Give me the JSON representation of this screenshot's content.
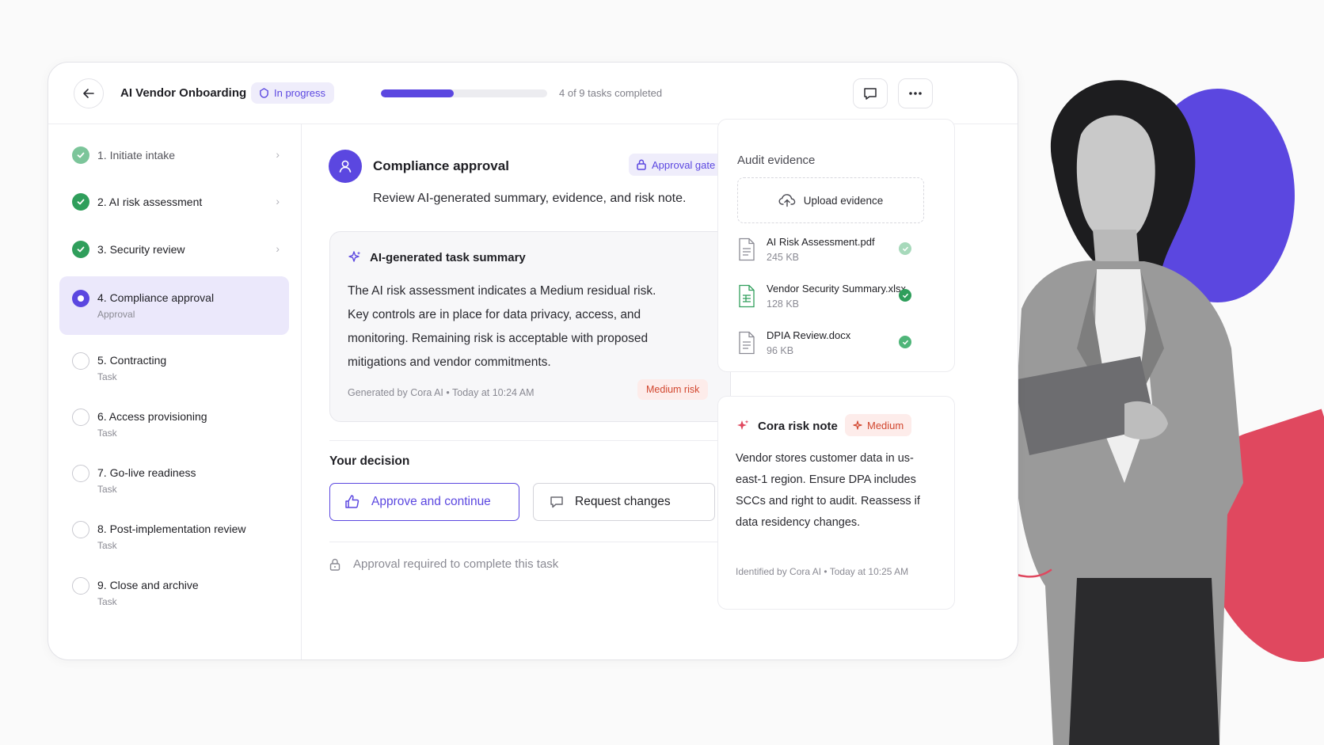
{
  "header": {
    "title": "AI Vendor Onboarding",
    "status": "In progress",
    "progress_fraction": 0.44,
    "progress_text": "4 of 9 tasks completed"
  },
  "sidebar": {
    "steps": [
      {
        "title": "1. Initiate intake",
        "subtitle": "",
        "state": "done-light"
      },
      {
        "title": "2. AI risk assessment",
        "subtitle": "",
        "state": "done"
      },
      {
        "title": "3. Security review",
        "subtitle": "",
        "state": "done"
      },
      {
        "title": "4. Compliance approval",
        "subtitle": "Approval",
        "state": "current"
      },
      {
        "title": "5. Contracting",
        "subtitle": "Task",
        "state": "todo"
      },
      {
        "title": "6. Access provisioning",
        "subtitle": "Task",
        "state": "todo"
      },
      {
        "title": "7. Go-live readiness",
        "subtitle": "Task",
        "state": "todo"
      },
      {
        "title": "8. Post-implementation review",
        "subtitle": "Task",
        "state": "todo"
      },
      {
        "title": "9. Close and archive",
        "subtitle": "Task",
        "state": "todo"
      }
    ]
  },
  "task": {
    "title": "Compliance approval",
    "gate_label": "Approval gate",
    "description": "Review AI-generated summary, evidence, and risk note.",
    "summary": {
      "heading": "AI-generated task summary",
      "body": "The AI risk assessment indicates a Medium residual risk. Key controls are in place for data privacy, access, and monitoring. Remaining risk is acceptable with proposed mitigations and vendor commitments.",
      "meta": "Generated by Cora AI • Today at 10:24 AM",
      "risk_label": "Medium risk"
    },
    "decision": {
      "label": "Your decision",
      "approve_label": "Approve and continue",
      "request_label": "Request changes"
    },
    "footer_note": "Approval required to complete this task"
  },
  "audit": {
    "title": "Audit evidence",
    "upload_label": "Upload evidence",
    "files": [
      {
        "name": "AI Risk Assessment.pdf",
        "size": "245 KB",
        "icon": "document-icon"
      },
      {
        "name": "Vendor Security Summary.xlsx",
        "size": "128 KB",
        "icon": "spreadsheet-icon"
      },
      {
        "name": "DPIA Review.docx",
        "size": "96 KB",
        "icon": "document-icon"
      }
    ]
  },
  "risk_note": {
    "title": "Cora risk note",
    "level": "Medium",
    "body": "Vendor stores customer data in us-east-1 region. Ensure DPA includes SCCs and right to audit. Reassess if data residency changes.",
    "meta": "Identified by Cora AI • Today at 10:25 AM"
  },
  "colors": {
    "accent": "#5b47e0",
    "success": "#2f9e5b",
    "danger": "#d2472f",
    "decor_red": "#e0485f"
  }
}
